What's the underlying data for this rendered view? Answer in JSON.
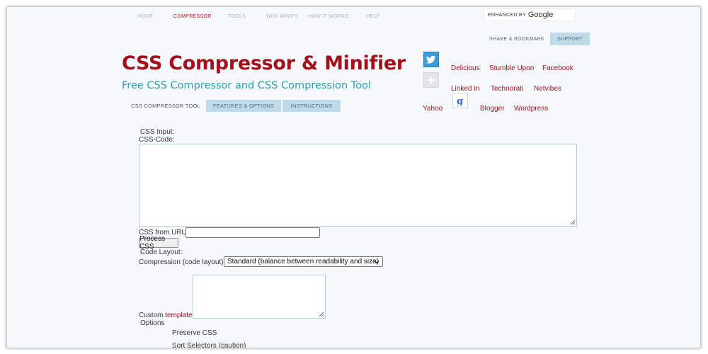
{
  "topnav": {
    "items": [
      {
        "label": "HOME"
      },
      {
        "label": "COMPRESSOR"
      },
      {
        "label": "TOOLS"
      },
      {
        "label": "WHY MINIFY"
      },
      {
        "label": "HOW IT WORKS"
      },
      {
        "label": "HELP"
      }
    ],
    "active": "COMPRESSOR",
    "search_prefix": "ENHANCED BY",
    "search_brand": "Google"
  },
  "share": {
    "bookmark_label": "SHARE & BOOKMARK",
    "support_label": "SUPPORT"
  },
  "header": {
    "title": "CSS Compressor & Minifier",
    "subtitle": "Free CSS Compressor and CSS Compression Tool"
  },
  "tabs": [
    {
      "label": "CSS COMPRESSOR TOOL"
    },
    {
      "label": "FEATURES & OPTIONS"
    },
    {
      "label": "INSTRUCTIONS"
    }
  ],
  "social": {
    "links": [
      "Delicious",
      "Stumble Upon",
      "Facebook",
      "Linked In",
      "Technorati",
      "Netvibes",
      "Yahoo",
      "Blogger",
      "Wordpress"
    ],
    "icons": [
      "twitter-icon",
      "share-plus-icon",
      "google-icon"
    ]
  },
  "form": {
    "css_input_label": "CSS Input:",
    "css_code_label": "CSS-Code:",
    "css_code_value": "",
    "css_url_label": "CSS from URL:",
    "css_url_value": "",
    "process_button": "Process CSS",
    "code_layout_label": "Code Layout:",
    "compression_label": "Compression (code layout):",
    "compression_selected": "Standard (balance between readability and size)",
    "custom_label": "Custom",
    "template_link": "template",
    "custom_template_value": "",
    "options_label": "Options",
    "option_preserve": "Preserve CSS",
    "option_sort": "Sort Selectors (caution)"
  },
  "colors": {
    "accent_red": "#a3121c",
    "accent_teal": "#2aa1b6",
    "tab_blue": "#bddbe9",
    "page_bg": "#f5f9fc"
  }
}
